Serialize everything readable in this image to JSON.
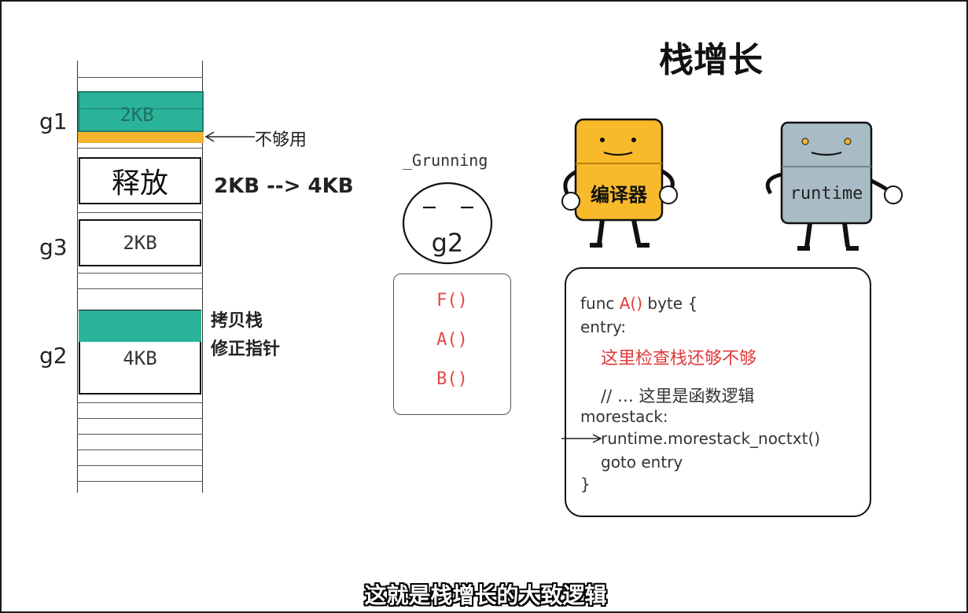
{
  "title": "栈增长",
  "memory": {
    "g1_label": "g1",
    "g1_block": "2KB",
    "g1_note": "不够用",
    "freed_block": "释放",
    "grow_note": "2KB --> 4KB",
    "g3_label": "g3",
    "g3_block": "2KB",
    "g2_label": "g2",
    "g2_block": "4KB",
    "copy_note_line1": "拷贝栈",
    "copy_note_line2": "修正指针"
  },
  "goroutine": {
    "state": "_Grunning",
    "name": "g2",
    "stack_frames": [
      "F()",
      "A()",
      "B()"
    ]
  },
  "characters": {
    "compiler": "编译器",
    "runtime": "runtime"
  },
  "code": {
    "line1_pre": "func ",
    "line1_fn": "A()",
    "line1_post": " byte {",
    "line2": "entry:",
    "line3": "这里检查栈还够不够",
    "line4": "// … 这里是函数逻辑",
    "line5": "morestack:",
    "line6": "runtime.morestack_noctxt()",
    "line7": "goto entry",
    "line8": "}"
  },
  "subtitle": "这就是栈增长的大致逻辑",
  "colors": {
    "teal": "#2bb39a",
    "orange": "#f3b52f",
    "compiler_body": "#f8b92a",
    "runtime_body": "#a9bcc6",
    "code_red": "#e23a3a"
  }
}
